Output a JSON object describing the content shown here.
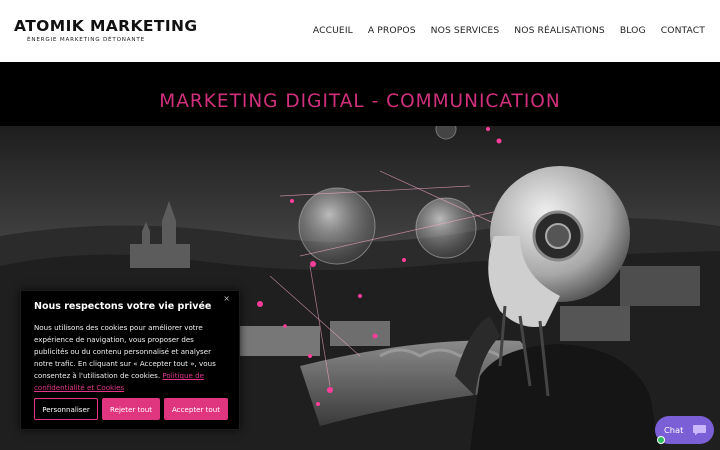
{
  "brand": {
    "name": "ATOMIK MARKETING",
    "tagline": "ÉNERGIE MARKETING DÉTONANTE"
  },
  "nav": {
    "items": [
      "ACCUEIL",
      "A PROPOS",
      "NOS SERVICES",
      "NOS RÉALISATIONS",
      "BLOG",
      "CONTACT"
    ]
  },
  "banner": {
    "title": "MARKETING DIGITAL - COMMUNICATION"
  },
  "cookie": {
    "title": "Nous respectons votre vie privée",
    "close_icon": "×",
    "text": "Nous utilisons des cookies pour améliorer votre expérience de navigation, vous proposer des publicités ou du contenu personnalisé et analyser notre trafic. En cliquant sur « Accepter tout », vous consentez à l'utilisation de cookies.",
    "link": "Politique de confidentialité et Cookies",
    "buttons": {
      "customize": "Personnaliser",
      "reject": "Rejeter tout",
      "accept": "Accepter tout"
    }
  },
  "chat": {
    "label": "Chat",
    "icon": "chat-bubble-icon"
  },
  "colors": {
    "accent": "#e0358a",
    "banner_title": "#d1307d",
    "chat": "#7b5fd6",
    "online": "#2fbf61"
  }
}
